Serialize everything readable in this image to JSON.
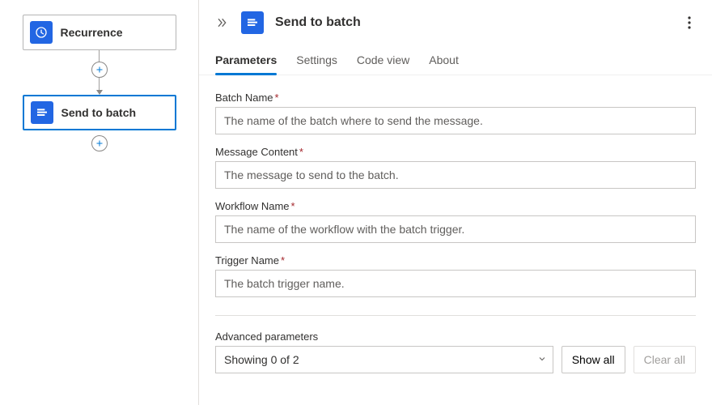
{
  "canvas": {
    "recurrence_label": "Recurrence",
    "batch_label": "Send to batch"
  },
  "panel": {
    "title": "Send to batch"
  },
  "tabs": {
    "parameters": "Parameters",
    "settings": "Settings",
    "code_view": "Code view",
    "about": "About"
  },
  "fields": {
    "batch_name": {
      "label": "Batch Name",
      "placeholder": "The name of the batch where to send the message."
    },
    "message_content": {
      "label": "Message Content",
      "placeholder": "The message to send to the batch."
    },
    "workflow_name": {
      "label": "Workflow Name",
      "placeholder": "The name of the workflow with the batch trigger."
    },
    "trigger_name": {
      "label": "Trigger Name",
      "placeholder": "The batch trigger name."
    }
  },
  "advanced": {
    "label": "Advanced parameters",
    "selected": "Showing 0 of 2",
    "show_all": "Show all",
    "clear_all": "Clear all"
  }
}
